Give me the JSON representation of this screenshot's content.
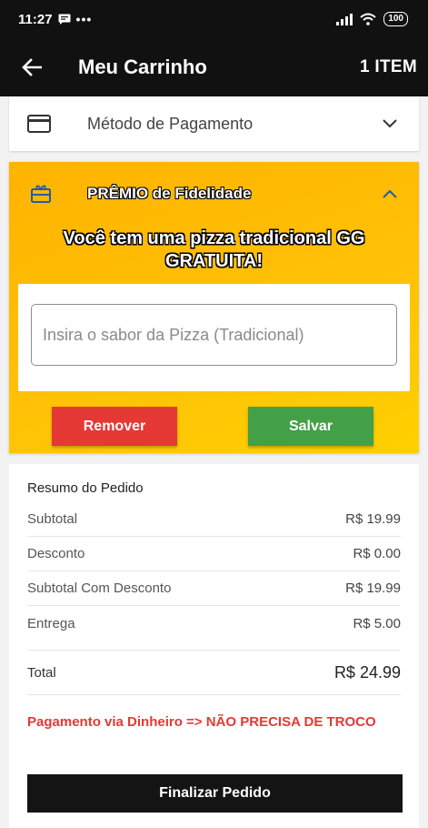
{
  "status_bar": {
    "time": "11:27",
    "dots": "•••",
    "battery": "100"
  },
  "header": {
    "title": "Meu Carrinho",
    "item_count": "1 ITEM"
  },
  "payment": {
    "label": "Método de Pagamento"
  },
  "reward": {
    "title": "PRÊMIO de Fidelidade",
    "message_line1": "Você tem uma pizza tradicional GG",
    "message_line2": "GRATUITA!",
    "input_placeholder": "Insira o sabor da Pizza (Tradicional)",
    "input_value": "",
    "remove_label": "Remover",
    "save_label": "Salvar",
    "colors": {
      "remove": "#e53935",
      "save": "#43a047",
      "banner": "#ffc107"
    }
  },
  "summary": {
    "title": "Resumo do Pedido",
    "rows": [
      {
        "label": "Subtotal",
        "value": "R$ 19.99"
      },
      {
        "label": "Desconto",
        "value": "R$ 0.00"
      },
      {
        "label": "Subtotal Com Desconto",
        "value": "R$ 19.99"
      },
      {
        "label": "Entrega",
        "value": "R$ 5.00"
      }
    ],
    "total_label": "Total",
    "total_value": "R$ 24.99",
    "payment_note": "Pagamento via Dinheiro => NÃO PRECISA DE TROCO",
    "finalize_label": "Finalizar Pedido"
  }
}
